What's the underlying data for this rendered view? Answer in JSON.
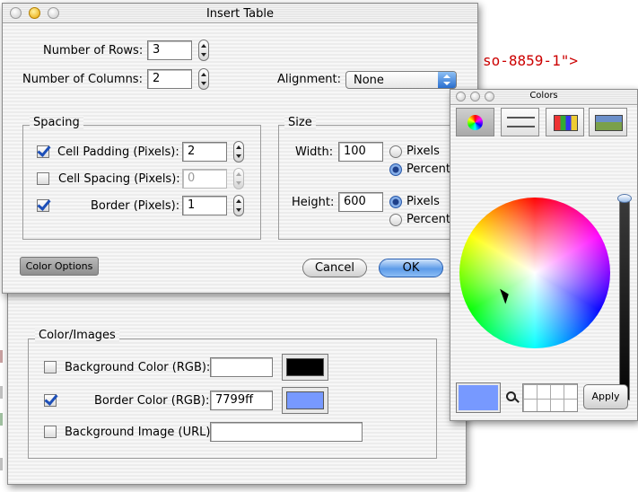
{
  "background": {
    "code_text": "so-8859-1\">"
  },
  "dialog": {
    "title": "Insert Table",
    "rows_label": "Number of Rows:",
    "rows_value": "3",
    "cols_label": "Number of Columns:",
    "cols_value": "2",
    "alignment_label": "Alignment:",
    "alignment_value": "None",
    "spacing": {
      "title": "Spacing",
      "padding_label": "Cell Padding (Pixels):",
      "padding_value": "2",
      "padding_checked": true,
      "cellspacing_label": "Cell Spacing (Pixels):",
      "cellspacing_value": "0",
      "cellspacing_checked": false,
      "border_label": "Border (Pixels):",
      "border_value": "1",
      "border_checked": true
    },
    "size": {
      "title": "Size",
      "width_label": "Width:",
      "width_value": "100",
      "width_unit_selected": "Percent",
      "height_label": "Height:",
      "height_value": "600",
      "height_unit_selected": "Pixels",
      "pixels_label": "Pixels",
      "percent_label": "Percent"
    },
    "color_options_label": "Color Options",
    "cancel_label": "Cancel",
    "ok_label": "OK"
  },
  "color_images": {
    "title": "Color/Images",
    "bg_color_label": "Background Color (RGB):",
    "bg_color_value": "",
    "bg_color_swatch": "#000000",
    "bg_color_checked": false,
    "border_color_label": "Border Color (RGB):",
    "border_color_value": "7799ff",
    "border_color_swatch": "#7799ff",
    "border_color_checked": true,
    "bg_image_label": "Background Image (URL):",
    "bg_image_value": "",
    "bg_image_checked": false
  },
  "colors_panel": {
    "title": "Colors",
    "mode_buttons": [
      "color-wheel-icon",
      "sliders-icon",
      "palette-icon",
      "image-palette-icon"
    ],
    "selected_mode": "color-wheel-icon",
    "current_color": "#7799ff",
    "apply_label": "Apply"
  }
}
